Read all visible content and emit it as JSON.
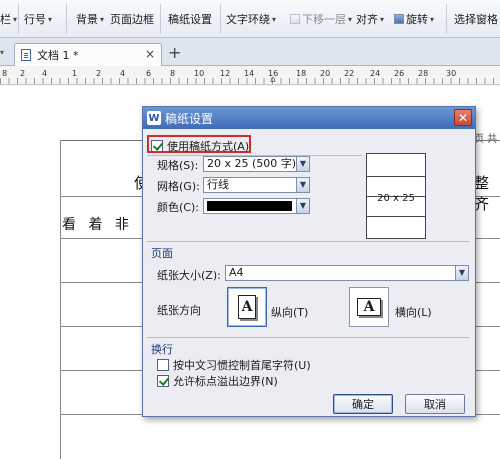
{
  "ribbon": {
    "items": [
      {
        "label": "栏",
        "dropdown": true
      },
      {
        "label": "行号",
        "dropdown": true
      },
      {
        "label": "背景",
        "dropdown": true
      },
      {
        "label": "页面边框"
      },
      {
        "label": "稿纸设置"
      },
      {
        "label": "文字环绕",
        "dropdown": true
      },
      {
        "label": "下移一层",
        "dropdown": true,
        "disabled": true
      },
      {
        "label": "对齐",
        "dropdown": true
      },
      {
        "label": "旋转",
        "dropdown": true
      },
      {
        "label": "选择窗格"
      }
    ]
  },
  "tabs": {
    "document_tab": "文档 1 *",
    "close": "×",
    "new_tab": "+"
  },
  "ruler": {
    "numbers": [
      "8",
      "2",
      "4",
      "1",
      "2",
      "4",
      "6",
      "8",
      "10",
      "12",
      "14",
      "16",
      "18",
      "20",
      "22",
      "24",
      "26",
      "28",
      "30"
    ]
  },
  "document": {
    "page_label": "页 共",
    "char_left": "使",
    "char_right": "整 齐",
    "text_line": "看 着 非 常 舒"
  },
  "dialog": {
    "title": "稿纸设置",
    "close": "✕",
    "use_grid": {
      "label": "使用稿纸方式(A)",
      "checked": true
    },
    "spec": {
      "label": "规格(S):",
      "value": "20 x 25 (500 字)"
    },
    "grid": {
      "label": "网格(G):",
      "value": "行线"
    },
    "color": {
      "label": "颜色(C):",
      "value": "#000000"
    },
    "preview_text": "20 x 25",
    "page_section": {
      "title": "页面",
      "paper_size_label": "纸张大小(Z):",
      "paper_size_value": "A4",
      "orientation_label": "纸张方向",
      "portrait": {
        "label": "纵向(T)",
        "selected": true
      },
      "landscape": {
        "label": "横向(L)",
        "selected": false
      }
    },
    "wrap_section": {
      "title": "换行",
      "option1": {
        "label": "按中文习惯控制首尾字符(U)",
        "checked": false
      },
      "option2": {
        "label": "允许标点溢出边界(N)",
        "checked": true
      }
    },
    "ok": "确定",
    "cancel": "取消"
  },
  "colors": {
    "title_bar": "#3e6cb8",
    "highlight_box": "#d42a2a",
    "dialog_bg": "#ecedf2"
  }
}
